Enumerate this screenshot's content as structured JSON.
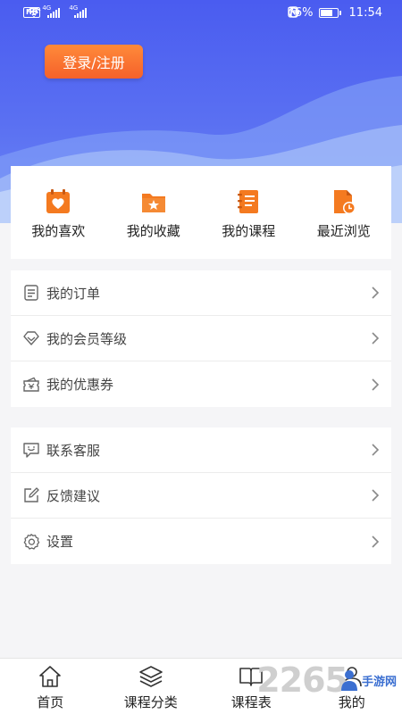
{
  "status_bar": {
    "hd": "HD",
    "net1": "4G",
    "net2": "4G",
    "battery_percent": "76%",
    "battery_level": 0.76,
    "time": "11:54"
  },
  "header": {
    "login_label": "登录/注册",
    "colors": {
      "gradient_top": "#4a5cf0",
      "gradient_bottom": "#6c86f5",
      "button": "#f5612a"
    }
  },
  "quick_actions": [
    {
      "label": "我的喜欢",
      "icon": "heart-calendar-icon"
    },
    {
      "label": "我的收藏",
      "icon": "star-folder-icon"
    },
    {
      "label": "我的课程",
      "icon": "notebook-icon"
    },
    {
      "label": "最近浏览",
      "icon": "clock-document-icon"
    }
  ],
  "menu_group_1": [
    {
      "label": "我的订单",
      "icon": "order-list-icon"
    },
    {
      "label": "我的会员等级",
      "icon": "diamond-icon"
    },
    {
      "label": "我的优惠券",
      "icon": "coupon-icon"
    }
  ],
  "menu_group_2": [
    {
      "label": "联系客服",
      "icon": "chat-icon"
    },
    {
      "label": "反馈建议",
      "icon": "edit-icon"
    },
    {
      "label": "设置",
      "icon": "gear-icon"
    }
  ],
  "bottom_nav": [
    {
      "label": "首页",
      "icon": "home-icon"
    },
    {
      "label": "课程分类",
      "icon": "layers-icon"
    },
    {
      "label": "课程表",
      "icon": "book-icon"
    },
    {
      "label": "我的",
      "icon": "user-icon"
    }
  ],
  "watermark": {
    "number": "2265",
    "text": "手游网"
  },
  "accent_orange": "#f47a20"
}
